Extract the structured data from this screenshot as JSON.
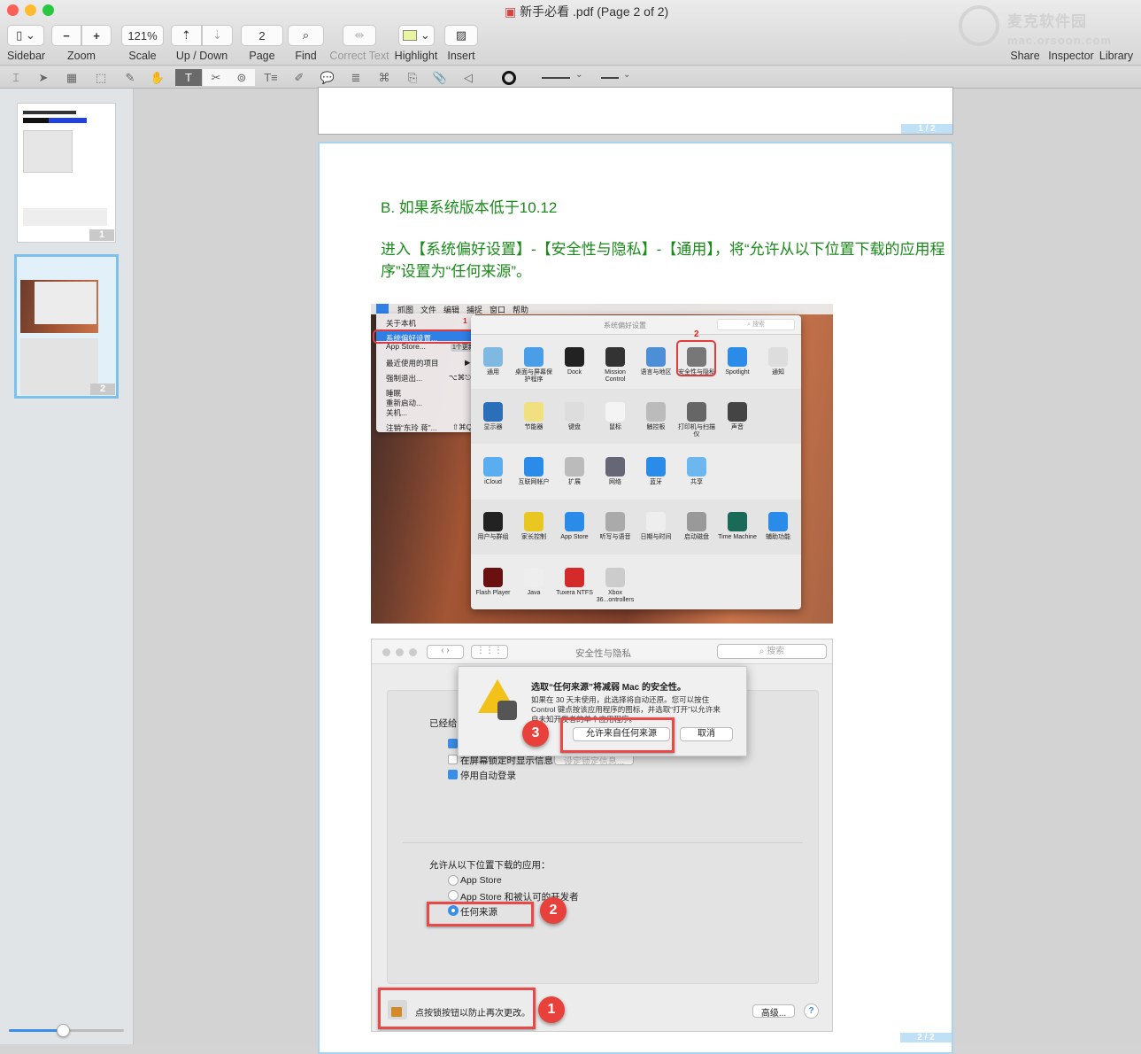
{
  "window": {
    "title": "新手必看 .pdf (Page 2 of 2)",
    "traffic_colors": [
      "#fc5f57",
      "#fdbc2e",
      "#29c840"
    ]
  },
  "toolbar": {
    "sidebar_label": "Sidebar",
    "zoom_label": "Zoom",
    "zoom_out": "−",
    "zoom_in": "+",
    "scale_label": "Scale",
    "scale_value": "121%",
    "updown_label": "Up / Down",
    "page_label": "Page",
    "page_value": "2",
    "find_label": "Find",
    "correct_text_label": "Correct Text",
    "highlight_label": "Highlight",
    "highlight_color": "#e9f5a0",
    "insert_label": "Insert",
    "share_label": "Share",
    "inspector_label": "Inspector",
    "library_label": "Library",
    "watermark": "麦克软件园 mac.orsoon.com"
  },
  "annotation_tools": [
    "text-selection-icon",
    "pointer-icon",
    "ocr-icon",
    "rectangle-select-icon",
    "pen-icon",
    "hand-icon",
    "text-annotation-icon",
    "shape-delete-icon",
    "stamp-icon",
    "text-box-icon",
    "highlighter-icon",
    "speech-bubble-icon",
    "note-icon",
    "crop-icon",
    "link-icon",
    "attachment-icon",
    "audio-icon"
  ],
  "sidebar": {
    "thumbnails": [
      {
        "number": "1"
      },
      {
        "number": "2",
        "selected": true
      }
    ],
    "thumb_size_fraction": 0.47
  },
  "document": {
    "page1_label": "1 / 2",
    "page2_label": "2 / 2",
    "heading": "B. 如果系统版本低于10.12",
    "instruction": "进入【系统偏好设置】-【安全性与隐私】-【通用】，将“允许从以下位置下载的应用程序”设置为“任何来源”。",
    "text_color": "#1a8a1a",
    "shot1": {
      "menubar": [
        "抓图",
        "文件",
        "编辑",
        "捕捉",
        "窗口",
        "帮助"
      ],
      "menu": [
        {
          "label": "关于本机",
          "y": "5"
        },
        {
          "label": "系统偏好设置...",
          "y": "22"
        },
        {
          "label": "App Store...",
          "y": "32"
        },
        {
          "label": "最近使用的项目",
          "y": "50"
        },
        {
          "label": "强制退出...",
          "y": "67"
        },
        {
          "label": "睡眠",
          "y": "84"
        },
        {
          "label": "重新启动...",
          "y": "95"
        },
        {
          "label": "关机...",
          "y": "106"
        },
        {
          "label": "注销“东玲 蒋”...",
          "y": "123"
        }
      ],
      "menu_shortcuts": {
        "appstore": "1个更新",
        "force_quit": "⌥⌘⎋",
        "logout": "⇧⌘Q",
        "recent": "▶"
      },
      "step1": "1",
      "step2": "2",
      "prefs_title": "系统偏好设置",
      "search_placeholder": "搜索",
      "prefs": [
        [
          {
            "label": "通用",
            "color": "#7fb8e0"
          },
          {
            "label": "桌面与屏幕保护程序",
            "color": "#4a9ee8"
          },
          {
            "label": "Dock",
            "color": "#222"
          },
          {
            "label": "Mission Control",
            "color": "#333"
          },
          {
            "label": "语言与地区",
            "color": "#4c8fd6"
          },
          {
            "label": "安全性与隐私",
            "color": "#777"
          },
          {
            "label": "Spotlight",
            "color": "#2a8ce8"
          },
          {
            "label": "通知",
            "color": "#ddd"
          }
        ],
        [
          {
            "label": "显示器",
            "color": "#2a6fb8"
          },
          {
            "label": "节能器",
            "color": "#f0e080"
          },
          {
            "label": "键盘",
            "color": "#ddd"
          },
          {
            "label": "鼠标",
            "color": "#f4f4f4"
          },
          {
            "label": "触控板",
            "color": "#bbb"
          },
          {
            "label": "打印机与扫描仪",
            "color": "#666"
          },
          {
            "label": "声音",
            "color": "#444"
          }
        ],
        [
          {
            "label": "iCloud",
            "color": "#5aaef0"
          },
          {
            "label": "互联网帐户",
            "color": "#2a8ce8"
          },
          {
            "label": "扩展",
            "color": "#bbb"
          },
          {
            "label": "网络",
            "color": "#667"
          },
          {
            "label": "蓝牙",
            "color": "#2a8ce8"
          },
          {
            "label": "共享",
            "color": "#6cb8ee"
          }
        ],
        [
          {
            "label": "用户与群组",
            "color": "#222"
          },
          {
            "label": "家长控制",
            "color": "#e8c820"
          },
          {
            "label": "App Store",
            "color": "#2a8ce8"
          },
          {
            "label": "听写与语音",
            "color": "#aaa"
          },
          {
            "label": "日期与时间",
            "color": "#eee"
          },
          {
            "label": "启动磁盘",
            "color": "#999"
          },
          {
            "label": "Time Machine",
            "color": "#1a6a5a"
          },
          {
            "label": "辅助功能",
            "color": "#2a8ce8"
          }
        ],
        [
          {
            "label": "Flash Player",
            "color": "#6a1010"
          },
          {
            "label": "Java",
            "color": "#eee"
          },
          {
            "label": "Tuxera NTFS",
            "color": "#d42a2a"
          },
          {
            "label": "Xbox 36...ontrollers",
            "color": "#ccc"
          }
        ]
      ]
    },
    "shot2": {
      "title": "安全性与隐私",
      "search_placeholder": "搜索",
      "dialog_title": "选取“任何来源”将减弱 Mac 的安全性。",
      "dialog_body": "如果在 30 天未使用，此选择将自动还原。您可以按住 Control 键点按该应用程序的图标，并选取“打开”以允许来自未知开发者的单个应用程序。",
      "allow_button": "允许来自任何来源",
      "cancel_button": "取消",
      "general_label": "已经给",
      "checkbox_password": "",
      "checkbox_lock_message": "在屏幕锁定时显示信息",
      "lock_message_button": "设定锁定信息...",
      "checkbox_autologin": "停用自动登录",
      "allow_from_label": "允许从以下位置下载的应用：",
      "radio_options": [
        "App Store",
        "App Store 和被认可的开发者",
        "任何来源"
      ],
      "selected_option": "任何来源",
      "lock_text": "点按锁按钮以防止再次更改。",
      "advanced_button": "高级...",
      "help": "?",
      "step1": "1",
      "step2": "2",
      "step3": "3"
    }
  }
}
